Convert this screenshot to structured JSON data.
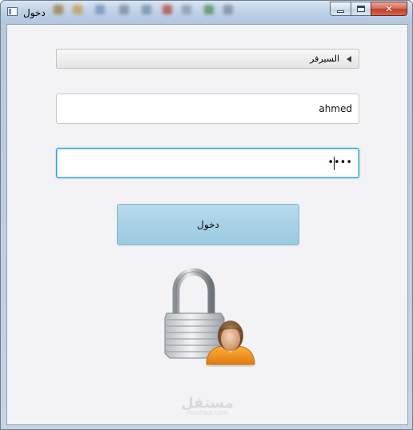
{
  "window": {
    "title": "دخول",
    "icon": "window-app-icon",
    "controls": [
      "minimize-icon",
      "maximize-icon",
      "close-icon"
    ]
  },
  "form": {
    "server_label": "السيرفر",
    "username_value": "ahmed",
    "password_value": "••••",
    "login_label": "دخول"
  },
  "illustration": {
    "icon": "lock-user-icon"
  },
  "watermark": {
    "brand": "مستقل",
    "domain": "mostaql.com"
  },
  "colors": {
    "accent_focus": "#3fa2d9",
    "button": "#a8d1e6",
    "client_bg": "#f3f2f4"
  }
}
